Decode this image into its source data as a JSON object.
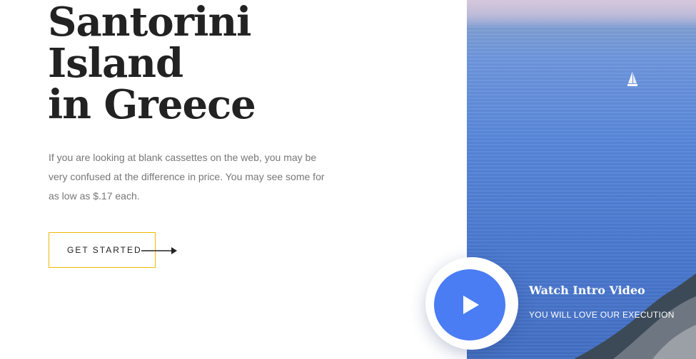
{
  "hero": {
    "title_lines": [
      "Santorini",
      "Island",
      "in Greece"
    ],
    "description": "If you are looking at blank cassettes on the web, you may be very confused at the difference in price. You may see some for as low as $.17 each.",
    "cta_label": "GET STARTED"
  },
  "video": {
    "title": "Watch Intro Video",
    "subtitle": "YOU WILL LOVE OUR EXECUTION"
  },
  "icons": {
    "cta": "arrow-right-icon",
    "video": "play-icon"
  },
  "colors": {
    "heading": "#222222",
    "body_text": "#777777",
    "cta_border": "#f2b705",
    "play_button": "#4a7cf3",
    "sea": "#5887da"
  }
}
